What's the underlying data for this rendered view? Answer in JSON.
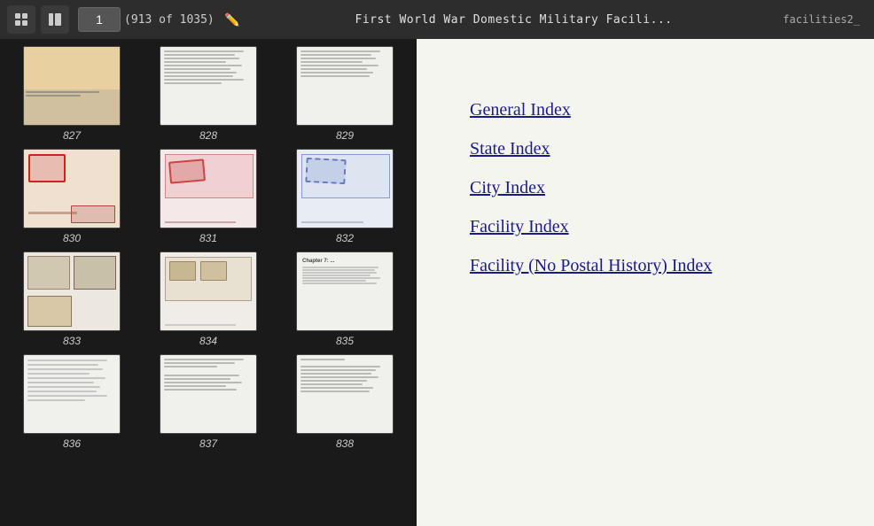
{
  "toolbar": {
    "page_input_value": "1",
    "page_count": "(913 of 1035)",
    "title": "First World War Domestic Military Facili...",
    "subtitle": "facilities2_",
    "icon1_label": "grid-icon",
    "icon2_label": "panel-icon",
    "pencil_label": "edit-icon"
  },
  "right_panel": {
    "index_items": [
      {
        "label": "General Index"
      },
      {
        "label": "State Index"
      },
      {
        "label": "City Index"
      },
      {
        "label": "Facility Index"
      },
      {
        "label": "Facility (No Postal History) Index"
      }
    ]
  },
  "thumbnails": [
    {
      "number": "827",
      "type": "postcard"
    },
    {
      "number": "828",
      "type": "text"
    },
    {
      "number": "829",
      "type": "text"
    },
    {
      "number": "830",
      "type": "postcard-red"
    },
    {
      "number": "831",
      "type": "postcard-pink"
    },
    {
      "number": "832",
      "type": "postcard-blue"
    },
    {
      "number": "833",
      "type": "postcard-mixed"
    },
    {
      "number": "834",
      "type": "postcard-stamps"
    },
    {
      "number": "835",
      "type": "dense-text"
    },
    {
      "number": "836",
      "type": "dense-text2"
    },
    {
      "number": "837",
      "type": "text2"
    },
    {
      "number": "838",
      "type": "list-text"
    }
  ]
}
